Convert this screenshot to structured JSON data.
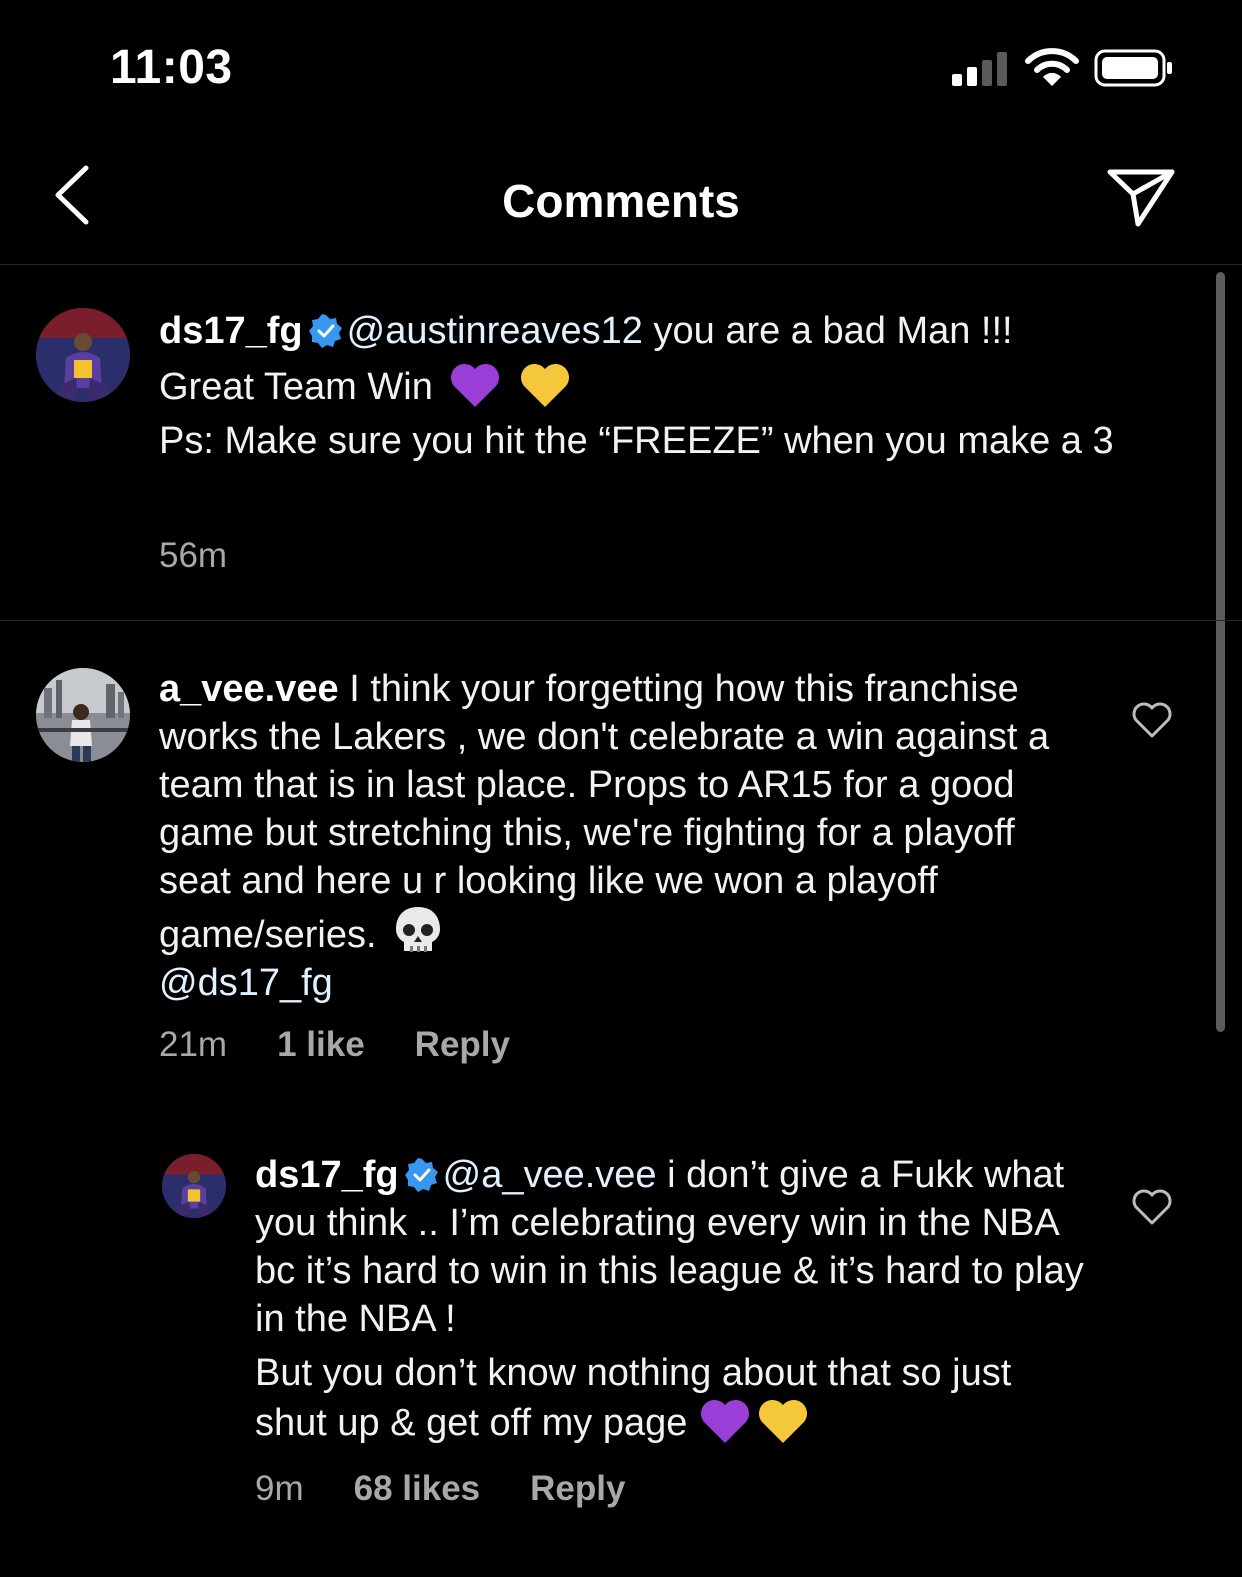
{
  "status_bar": {
    "time": "11:03"
  },
  "header": {
    "title": "Comments"
  },
  "comments": [
    {
      "username": "ds17_fg",
      "mention": "@austinreaves12",
      "line1_rest": " you are a bad Man !!!",
      "line2": "Great Team Win",
      "line3": "Ps: Make sure you hit the “FREEZE” when you make a 3",
      "time": "56m"
    },
    {
      "username": "a_vee.vee",
      "text": " I think your forgetting how this franchise works the Lakers , we don't celebrate a win against a team that is in last place. Props to AR15 for a good game but stretching this, we're fighting for a playoff seat and here u r looking like we won a playoff game/series.",
      "mention": "@ds17_fg",
      "time": "21m",
      "likes": "1 like",
      "reply": "Reply"
    },
    {
      "username": "ds17_fg",
      "mention": "@a_vee.vee",
      "text": " i don’t give a Fukk what you think .. I’m celebrating every win in the NBA bc it’s hard to win in this league & it’s hard to play in the NBA !",
      "text2": "But you don’t know nothing about that so just shut up & get off my page",
      "time": "9m",
      "likes": "68 likes",
      "reply": "Reply"
    }
  ]
}
